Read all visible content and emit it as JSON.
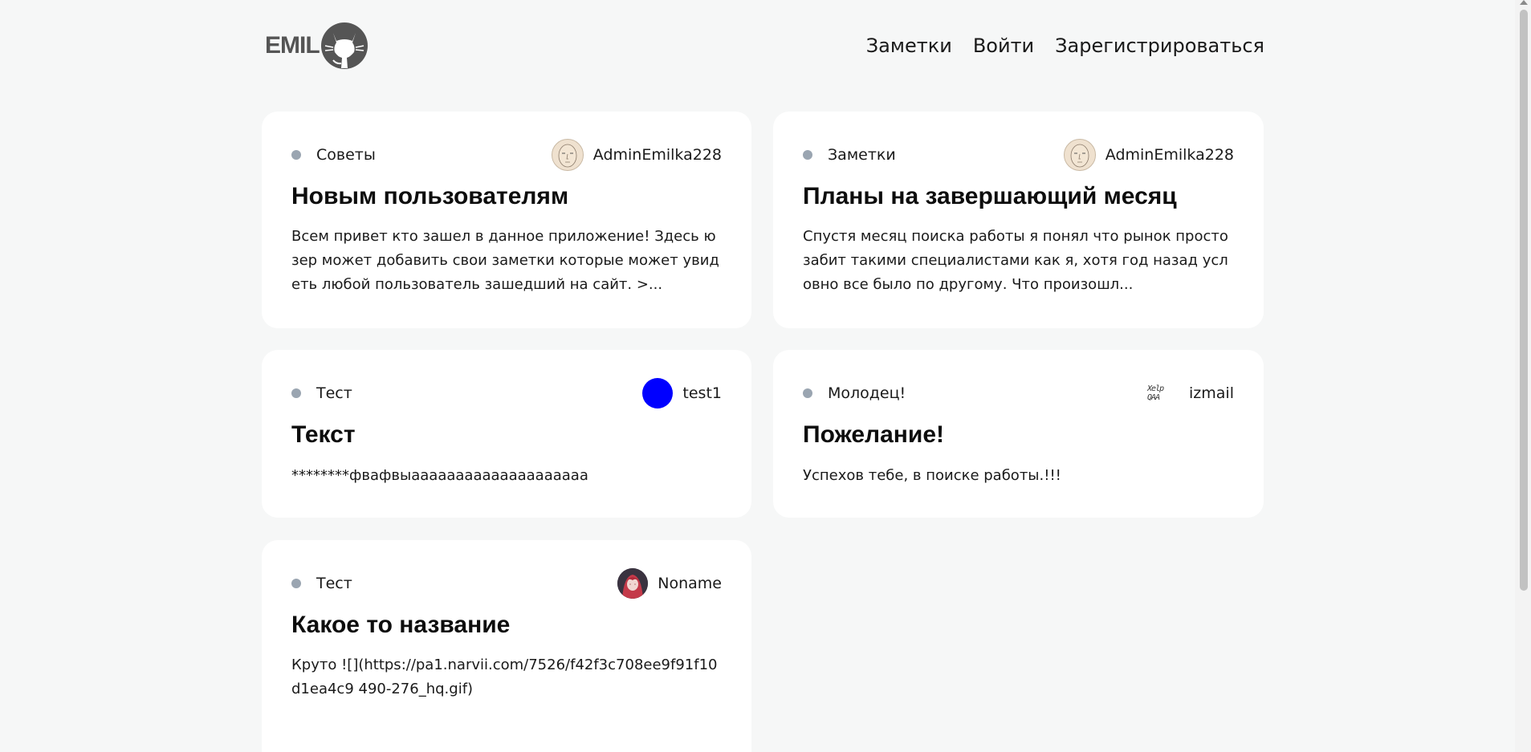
{
  "header": {
    "logo_text": "EMIL",
    "logo_icon": "github-cat-icon",
    "nav": [
      "Заметки",
      "Войти",
      "Зарегистрироваться"
    ]
  },
  "cards": [
    {
      "category": "Советы",
      "author": "AdminEmilka228",
      "avatar": "face-sketch-avatar",
      "title": "Новым пользователям",
      "text": "Всем привет кто зашел в данное приложение! Здесь юзер может добавить свои заметки которые может увидеть любой пользователь зашедший на сайт. >..."
    },
    {
      "category": "Заметки",
      "author": "AdminEmilka228",
      "avatar": "face-sketch-avatar",
      "title": "Планы на завершающий месяц",
      "text": "Спустя месяц поиска работы я понял что рынок просто забит такими специалистами как я, хотя год назад условно все было по другому. Что произошл..."
    },
    {
      "category": "Тест",
      "author": "test1",
      "avatar": "blue-circle-avatar",
      "avatar_color": "#0000ff",
      "title": "Текст",
      "text": "********фвафвыаааааааааааааааааааа"
    },
    {
      "category": "Молодец!",
      "author": "izmail",
      "avatar": "text-logo-avatar",
      "avatar_text": "Xelp QAA",
      "title": "Пожелание!",
      "text": "Успехов тебе, в поиске работы.!!!"
    },
    {
      "category": "Тест",
      "author": "Noname",
      "avatar": "anime-girl-avatar",
      "title": "Какое то название",
      "text": "Круто ![](https://pa1.narvii.com/7526/f42f3c708ee9f91f10d1ea4c9 490-276_hq.gif)"
    }
  ]
}
